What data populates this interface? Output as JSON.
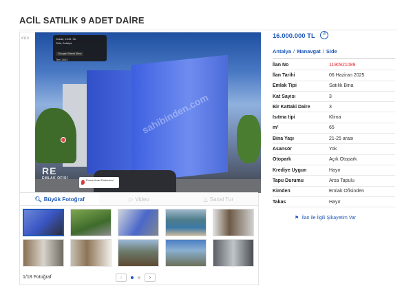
{
  "title": "ACİL SATILIK 9 ADET DAİRE",
  "gallery": {
    "street_view": {
      "photo_id": "#119",
      "address": "Sokak, 1043. Sk.",
      "city": "Side, Antalya",
      "button": "Google Street View",
      "date": "Tem 2022"
    },
    "watermark": "RE",
    "watermark_sub": "EMLAK OFİSİ",
    "map_label": "Prima Hotel Parkevleri",
    "site_watermark": "sahibinden.com",
    "tabs": [
      {
        "label": "Büyük Fotoğraf",
        "icon": "search-icon"
      },
      {
        "label": "Video",
        "icon": "video-icon"
      },
      {
        "label": "Sanal Tur",
        "icon": "virtual-tour-icon"
      }
    ],
    "photo_count": "1/18 Fotoğraf",
    "prev": "‹",
    "next": "›"
  },
  "listing": {
    "price": "16.000.000 TL",
    "price_icon": "price-history-icon",
    "location": [
      "Antalya",
      "Manavgat",
      "Side"
    ],
    "attributes": [
      {
        "key": "İlan No",
        "value": "1190921089",
        "highlight": true
      },
      {
        "key": "İlan Tarihi",
        "value": "06 Haziran 2025"
      },
      {
        "key": "Emlak Tipi",
        "value": "Satılık Bina"
      },
      {
        "key": "Kat Sayısı",
        "value": "3"
      },
      {
        "key": "Bir Kattaki Daire",
        "value": "3"
      },
      {
        "key": "Isıtma tipi",
        "value": "Klima"
      },
      {
        "key": "m²",
        "value": "65"
      },
      {
        "key": "Bina Yaşı",
        "value": "21-25 arası"
      },
      {
        "key": "Asansör",
        "value": "Yok"
      },
      {
        "key": "Otopark",
        "value": "Açık Otopark"
      },
      {
        "key": "Krediye Uygun",
        "value": "Hayır"
      },
      {
        "key": "Tapu Durumu",
        "value": "Arsa Tapulu"
      },
      {
        "key": "Kimden",
        "value": "Emlak Ofisinden"
      },
      {
        "key": "Takas",
        "value": "Hayır"
      }
    ],
    "report_link": "İlan ile İlgili Şikayetim Var"
  },
  "colors": {
    "accent": "#1f5ab9",
    "highlight": "#d9272e"
  }
}
